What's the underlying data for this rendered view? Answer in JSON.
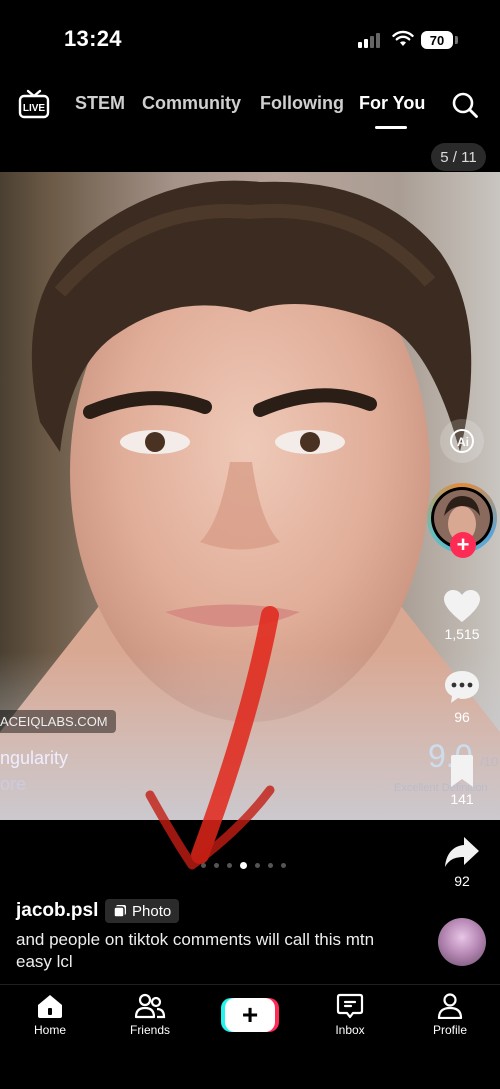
{
  "status_bar": {
    "time": "13:24",
    "battery": "70"
  },
  "top_nav": {
    "live_label": "LIVE",
    "tabs": [
      "STEM",
      "Community",
      "Following",
      "For You"
    ],
    "active_tab": "For You"
  },
  "photo_counter": "5 / 11",
  "photo_overlay": {
    "site": "ACEIQLABS.COM",
    "line1": "ngularity",
    "line2": "ore",
    "score": "9.0",
    "score_denom": "/10",
    "score_caption": "Excellent Definition"
  },
  "right_rail": {
    "ai_label": "Ai",
    "likes": "1,515",
    "comments": "96",
    "bookmarks": "141",
    "shares": "92"
  },
  "carousel": {
    "total": 7,
    "active": 3
  },
  "post": {
    "username": "jacob.psl",
    "type_badge": "Photo",
    "caption": "and people on tiktok comments will call this mtn easy lcl"
  },
  "bottom_nav": {
    "home": "Home",
    "friends": "Friends",
    "inbox": "Inbox",
    "profile": "Profile"
  },
  "colors": {
    "accent": "#fe2c55",
    "teal": "#25f4ee",
    "arrow": "#e0261a"
  }
}
